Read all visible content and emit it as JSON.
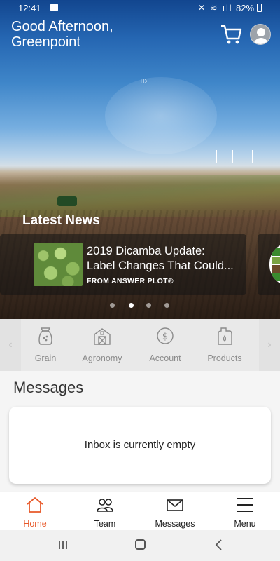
{
  "status_bar": {
    "time": "12:41",
    "battery": "82%"
  },
  "header": {
    "greeting_line1": "Good Afternoon,",
    "greeting_line2": "Greenpoint"
  },
  "news": {
    "section_title": "Latest News",
    "cards": [
      {
        "title_line1": "2019 Dicamba Update:",
        "title_line2": "Label Changes That Could",
        "source": "FROM ANSWER PLOT®"
      }
    ],
    "page_count": 4,
    "active_page": 2
  },
  "quick_nav": {
    "items": [
      {
        "label": "Grain",
        "icon": "grain-bag-icon"
      },
      {
        "label": "Agronomy",
        "icon": "barn-icon"
      },
      {
        "label": "Account",
        "icon": "dollar-coin-icon"
      },
      {
        "label": "Products",
        "icon": "jug-icon"
      }
    ]
  },
  "messages": {
    "title": "Messages",
    "empty_text": "Inbox is currently empty"
  },
  "bottom_nav": {
    "items": [
      {
        "label": "Home",
        "icon": "home-icon",
        "active": true
      },
      {
        "label": "Team",
        "icon": "team-icon",
        "active": false
      },
      {
        "label": "Messages",
        "icon": "envelope-icon",
        "active": false
      },
      {
        "label": "Menu",
        "icon": "hamburger-icon",
        "active": false
      }
    ]
  },
  "colors": {
    "accent": "#e8592a",
    "header_blue": "#12468f",
    "quick_nav_bg": "#e9e9e9"
  }
}
